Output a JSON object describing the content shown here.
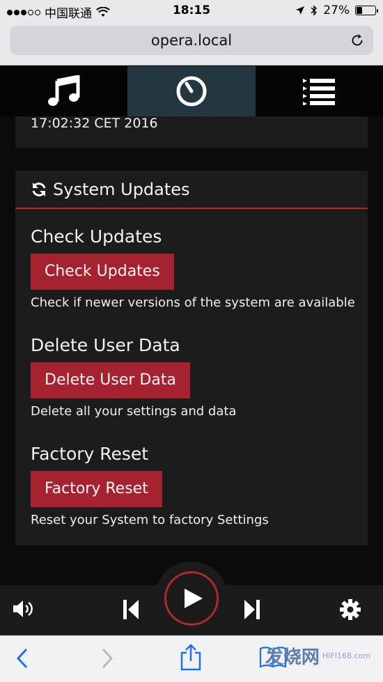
{
  "status_bar": {
    "carrier": "中国联通",
    "time": "18:15",
    "battery": "27%",
    "battery_level": 0.27
  },
  "browser": {
    "url": "opera.local"
  },
  "top_nav": {
    "tabs": [
      {
        "icon": "music-note-icon",
        "active": false
      },
      {
        "icon": "dial-knob-icon",
        "active": true
      },
      {
        "icon": "playlist-icon",
        "active": false
      }
    ]
  },
  "system_info": {
    "date_text": "17:02:32 CET 2016"
  },
  "system_updates": {
    "title": "System Updates",
    "sections": {
      "check": {
        "heading": "Check Updates",
        "button": "Check Updates",
        "description": "Check if newer versions of the system are available"
      },
      "delete": {
        "heading": "Delete User Data",
        "button": "Delete User Data",
        "description": "Delete all your settings and data"
      },
      "reset": {
        "heading": "Factory Reset",
        "button": "Factory Reset",
        "description": "Reset your System to factory Settings"
      }
    }
  },
  "player": {
    "icons": [
      "volume-icon",
      "previous-track-icon",
      "play-icon",
      "next-track-icon",
      "settings-gear-icon"
    ]
  },
  "watermark": {
    "text": "发烧网",
    "domain": "HIFI168.com"
  },
  "colors": {
    "accent_red": "#a52330",
    "active_tab": "#243640",
    "card_bg": "#1c1c1c"
  }
}
